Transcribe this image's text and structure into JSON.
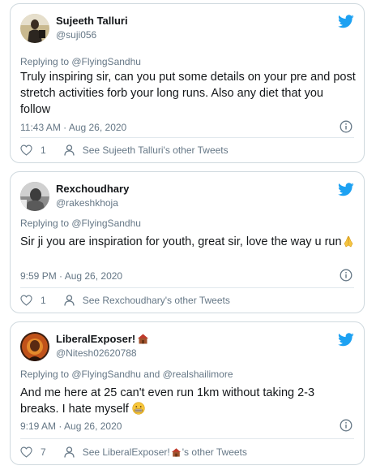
{
  "colors": {
    "twitter_blue": "#1da1f2",
    "text_primary": "#14171a",
    "text_secondary": "#657786",
    "border": "#cfd9de"
  },
  "tweets": [
    {
      "name": "Sujeeth Talluri",
      "handle": "@suji056",
      "replying": "Replying to @FlyingSandhu",
      "text": "Truly inspiring sir, can you put some details on your pre and post stretch activities forb your long runs. Also any diet that you follow",
      "time": "11:43 AM · Aug 26, 2020",
      "likes": "1",
      "other_tweets": "See Sujeeth Talluri's other Tweets",
      "avatar_icon": "user-photo",
      "bird_icon": "twitter-bird-icon",
      "info_icon": "info-icon"
    },
    {
      "name": "Rexchoudhary",
      "handle": "@rakeshkhoja",
      "replying": "Replying to @FlyingSandhu",
      "text": "Sir ji you are inspiration for youth, great sir, love the way u run",
      "emoji": "folded-hands-emoji",
      "time": "9:59 PM · Aug 26, 2020",
      "likes": "1",
      "other_tweets": "See Rexchoudhary's other Tweets",
      "avatar_icon": "user-photo",
      "bird_icon": "twitter-bird-icon",
      "info_icon": "info-icon"
    },
    {
      "name": "LiberalExposer!",
      "name_emoji": "house-emoji",
      "handle": "@Nitesh02620788",
      "replying": "Replying to @FlyingSandhu and @realshailimore",
      "text": "And me here at 25 can't even run 1km without taking 2-3 breaks. I hate myself",
      "emoji": "grimacing-face-emoji",
      "time": "9:19 AM · Aug 26, 2020",
      "likes": "7",
      "other_tweets_prefix": "See LiberalExposer!",
      "other_tweets_suffix": "'s other Tweets",
      "avatar_icon": "user-photo",
      "bird_icon": "twitter-bird-icon",
      "info_icon": "info-icon"
    }
  ]
}
